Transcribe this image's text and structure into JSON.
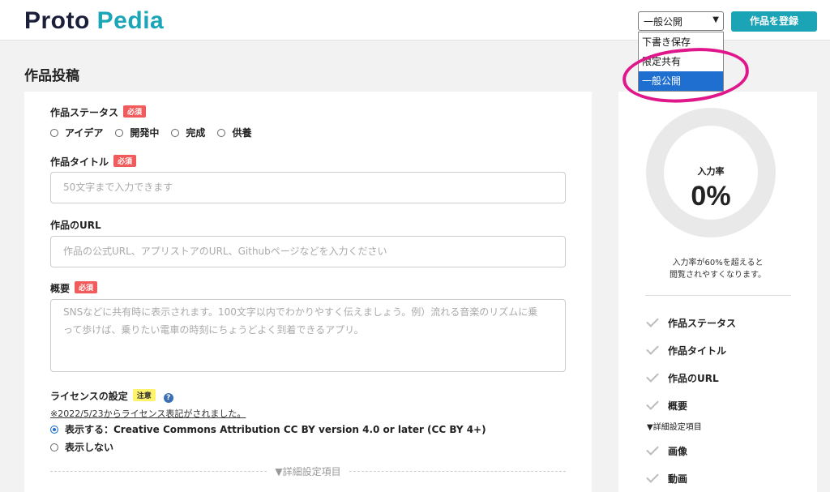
{
  "header": {
    "logo_main": "Proto ",
    "logo_accent": "Pedia",
    "status_select_value": "一般公開",
    "status_options": [
      "下書き保存",
      "限定共有",
      "一般公開"
    ],
    "register_label": "作品を登録"
  },
  "page": {
    "title": "作品投稿"
  },
  "form": {
    "status": {
      "label": "作品ステータス",
      "badge": "必須",
      "options": [
        "アイデア",
        "開発中",
        "完成",
        "供養"
      ]
    },
    "title": {
      "label": "作品タイトル",
      "badge": "必須",
      "placeholder": "50文字まで入力できます"
    },
    "url": {
      "label": "作品のURL",
      "placeholder": "作品の公式URL、アプリストアのURL、Githubページなどを入力ください"
    },
    "summary": {
      "label": "概要",
      "badge": "必須",
      "placeholder_line1": "SNSなどに共有時に表示されます。100文字以内でわかりやすく伝えましょう。例）流れる音楽のリズムに乗",
      "placeholder_line2": "って歩けば、乗りたい電車の時刻にちょうどよく到着できるアプリ。"
    },
    "license": {
      "label": "ライセンスの設定",
      "badge": "注意",
      "help_icon": "?",
      "note": "※2022/5/23からライセンス表記がされました。",
      "option_show": "表示する：Creative Commons Attribution CC BY version 4.0 or later (CC BY 4+)",
      "option_hide": "表示しない",
      "selected": "show"
    },
    "details_toggle": "▼詳細設定項目"
  },
  "sidebar": {
    "progress_label": "入力率",
    "progress_value": "0%",
    "note_line1": "入力率が60%を超えると",
    "note_line2": "閲覧されやすくなります。",
    "checklist": [
      "作品ステータス",
      "作品タイトル",
      "作品のURL",
      "概要"
    ],
    "details_heading": "▼詳細設定項目",
    "details_checklist": [
      "画像",
      "動画"
    ]
  },
  "colors": {
    "accent": "#1ba3b6",
    "required_badge": "#f15b5b",
    "note_badge": "#fff36b",
    "highlight": "#e0168b",
    "selected_option": "#1f6fd1"
  }
}
